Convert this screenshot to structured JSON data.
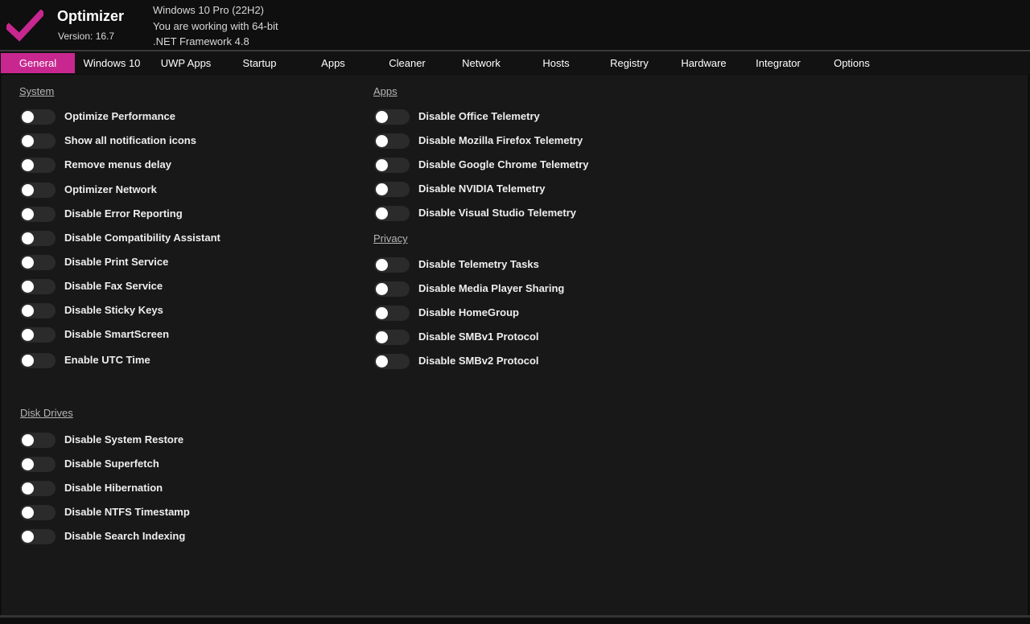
{
  "app": {
    "title": "Optimizer",
    "version": "Version: 16.7",
    "accent_color": "#c8278f",
    "logo_icon": "check-mark"
  },
  "system_info": {
    "os": "Windows 10 Pro (22H2)",
    "arch": "You are working with 64-bit",
    "framework": ".NET Framework 4.8"
  },
  "tabs": [
    {
      "label": "General",
      "active": true
    },
    {
      "label": "Windows 10",
      "active": false
    },
    {
      "label": "UWP Apps",
      "active": false
    },
    {
      "label": "Startup",
      "active": false
    },
    {
      "label": "Apps",
      "active": false
    },
    {
      "label": "Cleaner",
      "active": false
    },
    {
      "label": "Network",
      "active": false
    },
    {
      "label": "Hosts",
      "active": false
    },
    {
      "label": "Registry",
      "active": false
    },
    {
      "label": "Hardware",
      "active": false
    },
    {
      "label": "Integrator",
      "active": false
    },
    {
      "label": "Options",
      "active": false
    }
  ],
  "sections": {
    "system": {
      "title": "System",
      "items": [
        {
          "label": "Optimize Performance",
          "on": false
        },
        {
          "label": "Show all notification icons",
          "on": false
        },
        {
          "label": "Remove menus delay",
          "on": false
        },
        {
          "label": "Optimizer Network",
          "on": false
        },
        {
          "label": "Disable Error Reporting",
          "on": false
        },
        {
          "label": "Disable Compatibility Assistant",
          "on": false
        },
        {
          "label": "Disable Print Service",
          "on": false
        },
        {
          "label": "Disable Fax Service",
          "on": false
        },
        {
          "label": "Disable Sticky Keys",
          "on": false
        },
        {
          "label": "Disable SmartScreen",
          "on": false
        },
        {
          "label": "Enable UTC Time",
          "on": false
        }
      ]
    },
    "disk_drives": {
      "title": "Disk Drives",
      "items": [
        {
          "label": "Disable System Restore",
          "on": false
        },
        {
          "label": "Disable Superfetch",
          "on": false
        },
        {
          "label": "Disable Hibernation",
          "on": false
        },
        {
          "label": "Disable NTFS Timestamp",
          "on": false
        },
        {
          "label": "Disable Search Indexing",
          "on": false
        }
      ]
    },
    "apps": {
      "title": "Apps",
      "items": [
        {
          "label": "Disable Office Telemetry",
          "on": false
        },
        {
          "label": "Disable Mozilla Firefox Telemetry",
          "on": false
        },
        {
          "label": "Disable Google Chrome Telemetry",
          "on": false
        },
        {
          "label": "Disable NVIDIA Telemetry",
          "on": false
        },
        {
          "label": "Disable Visual Studio Telemetry",
          "on": false
        }
      ]
    },
    "privacy": {
      "title": "Privacy",
      "items": [
        {
          "label": "Disable Telemetry Tasks",
          "on": false
        },
        {
          "label": "Disable Media Player Sharing",
          "on": false
        },
        {
          "label": "Disable HomeGroup",
          "on": false
        },
        {
          "label": "Disable SMBv1 Protocol",
          "on": false
        },
        {
          "label": "Disable SMBv2 Protocol",
          "on": false
        }
      ]
    }
  }
}
